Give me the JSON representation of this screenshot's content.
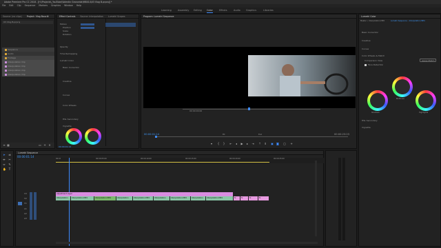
{
  "app": {
    "title": "Adobe Premiere Pro CC 2018 - [H:\\Projects\\_YouTube\\Valentin Grancelot\\MB014\\03 Vlog B.prproj] *"
  },
  "menu": [
    "File",
    "Edit",
    "Clip",
    "Sequence",
    "Markers",
    "Graphics",
    "Window",
    "Help"
  ],
  "workspaces": [
    "Learning",
    "Assembly",
    "Editing",
    "Color",
    "Effects",
    "Audio",
    "Graphics",
    "Libraries"
  ],
  "project_panel": {
    "tabs": [
      "Source: (no clips)",
      "Project: Vlog Bouclé"
    ],
    "items": [
      "03 Vlog B.prproj",
      "Sequence",
      "Audio",
      "Footage",
      "Interpolation Clip",
      "Interpolation Clip",
      "Interpolation Clip",
      "Interpolation Clip"
    ]
  },
  "effect_controls": {
    "tabs": [
      "Effect Controls",
      "Source: Interpolation",
      "Lumetri Scopes"
    ],
    "sections": [
      "Motion",
      "Position",
      "Scale",
      "Rotation",
      "Opacity",
      "Time Remapping",
      "Lumetri Color",
      "Basic Correction",
      "Creative",
      "Curves",
      "Color Wheels",
      "HSL Secondary",
      "Vignette"
    ],
    "timecode": "00:00:01:14"
  },
  "program_monitor": {
    "tab": "Program: Lumetri Sequence",
    "timecode_current": "00:00:01:14",
    "fit": "Fit",
    "resolution": "Full",
    "timecode_duration": "00:00:23:23",
    "center_timecode": "00:00:00:00"
  },
  "lumetri_panel": {
    "tabs": [
      "Lumetri Color"
    ],
    "header_source": "Master • Interpolation.MP4",
    "header_seq": "Lumetri Sequence • Interpolation.MP4",
    "sections": [
      "Basic Correction",
      "Creative",
      "Curves",
      "Color Wheels & Match",
      "HSL Secondary",
      "Vignette"
    ],
    "comparison_view": "Comparison View",
    "face_detection": "Face Detection",
    "apply_match": "Apply Match",
    "wheel_labels": [
      "Shadows",
      "Midtones",
      "Highlights"
    ]
  },
  "timeline": {
    "tab": "Lumetri Sequence",
    "timecode": "00:00:01:14",
    "ruler": [
      "00:00",
      "00:00:05:00",
      "00:00:10:00",
      "00:00:15:00",
      "00:00:20:00",
      "00:00:25:00"
    ],
    "tracks": [
      "V3",
      "V2",
      "V1",
      "A1",
      "A2",
      "A3"
    ],
    "clips_v1": [
      "Interpolation",
      "Interpolation.MP4",
      "Interpolation.MP4",
      "Interpolation",
      "Interpolation.MP4",
      "Interpolation",
      "Interpolation.MP4",
      "Interpolation",
      "Interpolation.MP4"
    ],
    "clips_v1_pink": [
      "fx",
      "fx",
      "fx",
      "fx"
    ],
    "adjustment_layer": "Adjustment Layer"
  },
  "colors": {
    "accent": "#3d8bff",
    "clip_green": "#8ac7a6",
    "clip_pink": "#e79ae0",
    "adjustment": "#d98ce0",
    "in_out_bar": "#d5c246"
  }
}
